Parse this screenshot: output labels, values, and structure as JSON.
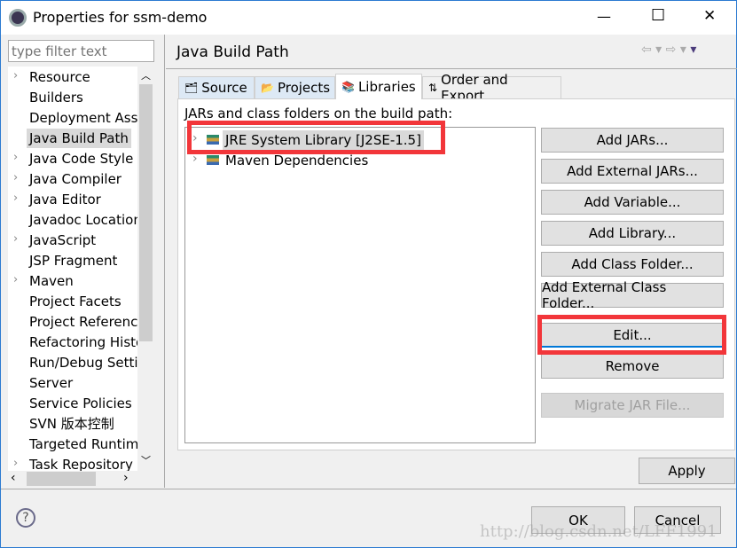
{
  "window": {
    "title": "Properties for ssm-demo",
    "minimize": "—",
    "maximize": "☐",
    "close": "✕"
  },
  "sidebar": {
    "filter_placeholder": "type filter text",
    "items": [
      {
        "label": "Resource",
        "expandable": true
      },
      {
        "label": "Builders",
        "expandable": false
      },
      {
        "label": "Deployment Assembly",
        "expandable": false
      },
      {
        "label": "Java Build Path",
        "expandable": false,
        "selected": true
      },
      {
        "label": "Java Code Style",
        "expandable": true
      },
      {
        "label": "Java Compiler",
        "expandable": true
      },
      {
        "label": "Java Editor",
        "expandable": true
      },
      {
        "label": "Javadoc Location",
        "expandable": false
      },
      {
        "label": "JavaScript",
        "expandable": true
      },
      {
        "label": "JSP Fragment",
        "expandable": false
      },
      {
        "label": "Maven",
        "expandable": true
      },
      {
        "label": "Project Facets",
        "expandable": false
      },
      {
        "label": "Project References",
        "expandable": false
      },
      {
        "label": "Refactoring History",
        "expandable": false
      },
      {
        "label": "Run/Debug Settings",
        "expandable": false
      },
      {
        "label": "Server",
        "expandable": false
      },
      {
        "label": "Service Policies",
        "expandable": false
      },
      {
        "label": "SVN 版本控制",
        "expandable": false
      },
      {
        "label": "Targeted Runtimes",
        "expandable": false
      },
      {
        "label": "Task Repository",
        "expandable": true
      }
    ]
  },
  "main": {
    "title": "Java Build Path",
    "tabs": [
      {
        "label": "Source"
      },
      {
        "label": "Projects"
      },
      {
        "label": "Libraries",
        "active": true
      },
      {
        "label": "Order and Export"
      }
    ],
    "list_label": "JARs and class folders on the build path:",
    "entries": [
      {
        "label": "JRE System Library [J2SE-1.5]",
        "selected": true
      },
      {
        "label": "Maven Dependencies"
      }
    ],
    "buttons": [
      {
        "label": "Add JARs...",
        "enabled": true
      },
      {
        "label": "Add External JARs...",
        "enabled": true
      },
      {
        "label": "Add Variable...",
        "enabled": true
      },
      {
        "label": "Add Library...",
        "enabled": true
      },
      {
        "label": "Add Class Folder...",
        "enabled": true
      },
      {
        "label": "Add External Class Folder...",
        "enabled": true
      },
      {
        "label": "Edit...",
        "enabled": true,
        "focused": true
      },
      {
        "label": "Remove",
        "enabled": true
      },
      {
        "label": "Migrate JAR File...",
        "enabled": false
      }
    ],
    "apply": "Apply"
  },
  "footer": {
    "ok": "OK",
    "cancel": "Cancel",
    "help": "?",
    "watermark": "http://blog.csdn.net/LFF1991"
  },
  "colors": {
    "highlight": "#f2363a",
    "focus": "#0078d7",
    "window_border": "#2b7bd1"
  }
}
